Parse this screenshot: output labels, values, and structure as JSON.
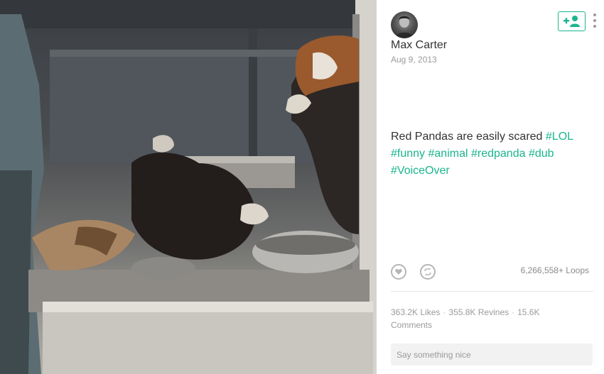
{
  "post": {
    "author_name": "Max Carter",
    "date": "Aug 9, 2013",
    "caption_text": "Red Pandas are easily scared ",
    "hashtags": [
      "#LOL",
      "#funny",
      "#animal",
      "#redpanda",
      "#dub",
      "#VoiceOver"
    ]
  },
  "actions": {
    "like_icon": "heart-icon",
    "revine_icon": "revine-icon",
    "follow_icon": "add-user-icon",
    "more_icon": "vertical-dots-icon"
  },
  "stats": {
    "loops": "6,266,558+ Loops",
    "likes": "363.2K Likes",
    "revines": "355.8K Revines",
    "comments": "15.6K Comments",
    "separator": "·"
  },
  "comment": {
    "placeholder": "Say something nice"
  },
  "colors": {
    "accent": "#1bb58d",
    "text_primary": "#333333",
    "text_muted": "#9a9a9a"
  }
}
